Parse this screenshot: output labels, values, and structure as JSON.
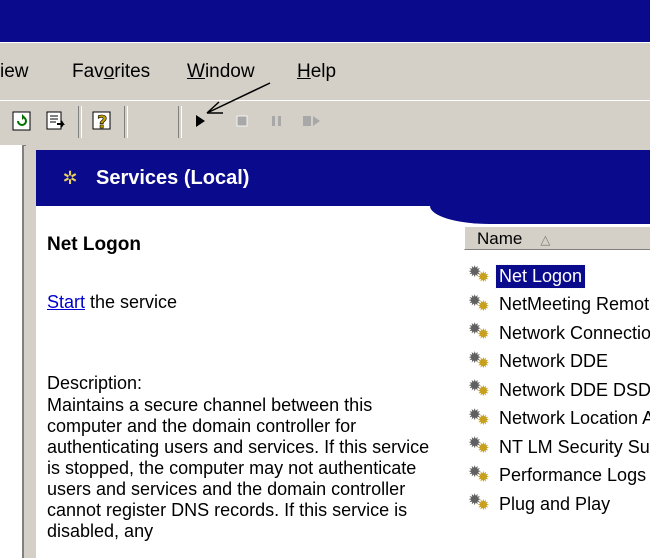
{
  "menu": {
    "view_partial": "iew",
    "favorites": {
      "before": "Fav",
      "mnemonic": "o",
      "after": "rites"
    },
    "window": {
      "before": "",
      "mnemonic": "W",
      "after": "indow"
    },
    "help": {
      "before": "",
      "mnemonic": "H",
      "after": "elp"
    }
  },
  "toolbar": {
    "refresh_icon": "refresh-icon",
    "export_icon": "export-list-icon",
    "help_icon": "help-icon",
    "play_icon": "start-service-icon",
    "stop_icon": "stop-service-icon",
    "pause_icon": "pause-service-icon",
    "restart_icon": "restart-service-icon"
  },
  "header": {
    "title": "Services (Local)",
    "icon": "services-gear-icon"
  },
  "detail": {
    "service_name": "Net Logon",
    "start_link": "Start",
    "start_suffix": " the service",
    "description_label": "Description:",
    "description": "Maintains a secure channel between this computer and the domain controller for authenticating users and services. If this service is stopped, the computer may not authenticate users and services and the domain controller cannot register DNS records. If this service is disabled, any"
  },
  "list": {
    "column_name": "Name",
    "sort_indicator": "△",
    "items": [
      {
        "label": "Net Logon",
        "selected": true
      },
      {
        "label": "NetMeeting Remote Desktop Sharing",
        "selected": false
      },
      {
        "label": "Network Connections",
        "selected": false
      },
      {
        "label": "Network DDE",
        "selected": false
      },
      {
        "label": "Network DDE DSDM",
        "selected": false
      },
      {
        "label": "Network Location Awareness",
        "selected": false
      },
      {
        "label": "NT LM Security Support Provider",
        "selected": false
      },
      {
        "label": "Performance Logs and Alerts",
        "selected": false
      },
      {
        "label": "Plug and Play",
        "selected": false
      }
    ]
  },
  "colors": {
    "title_blue": "#0a0a8c",
    "chrome": "#d4d0c8",
    "link": "#0000cc"
  }
}
